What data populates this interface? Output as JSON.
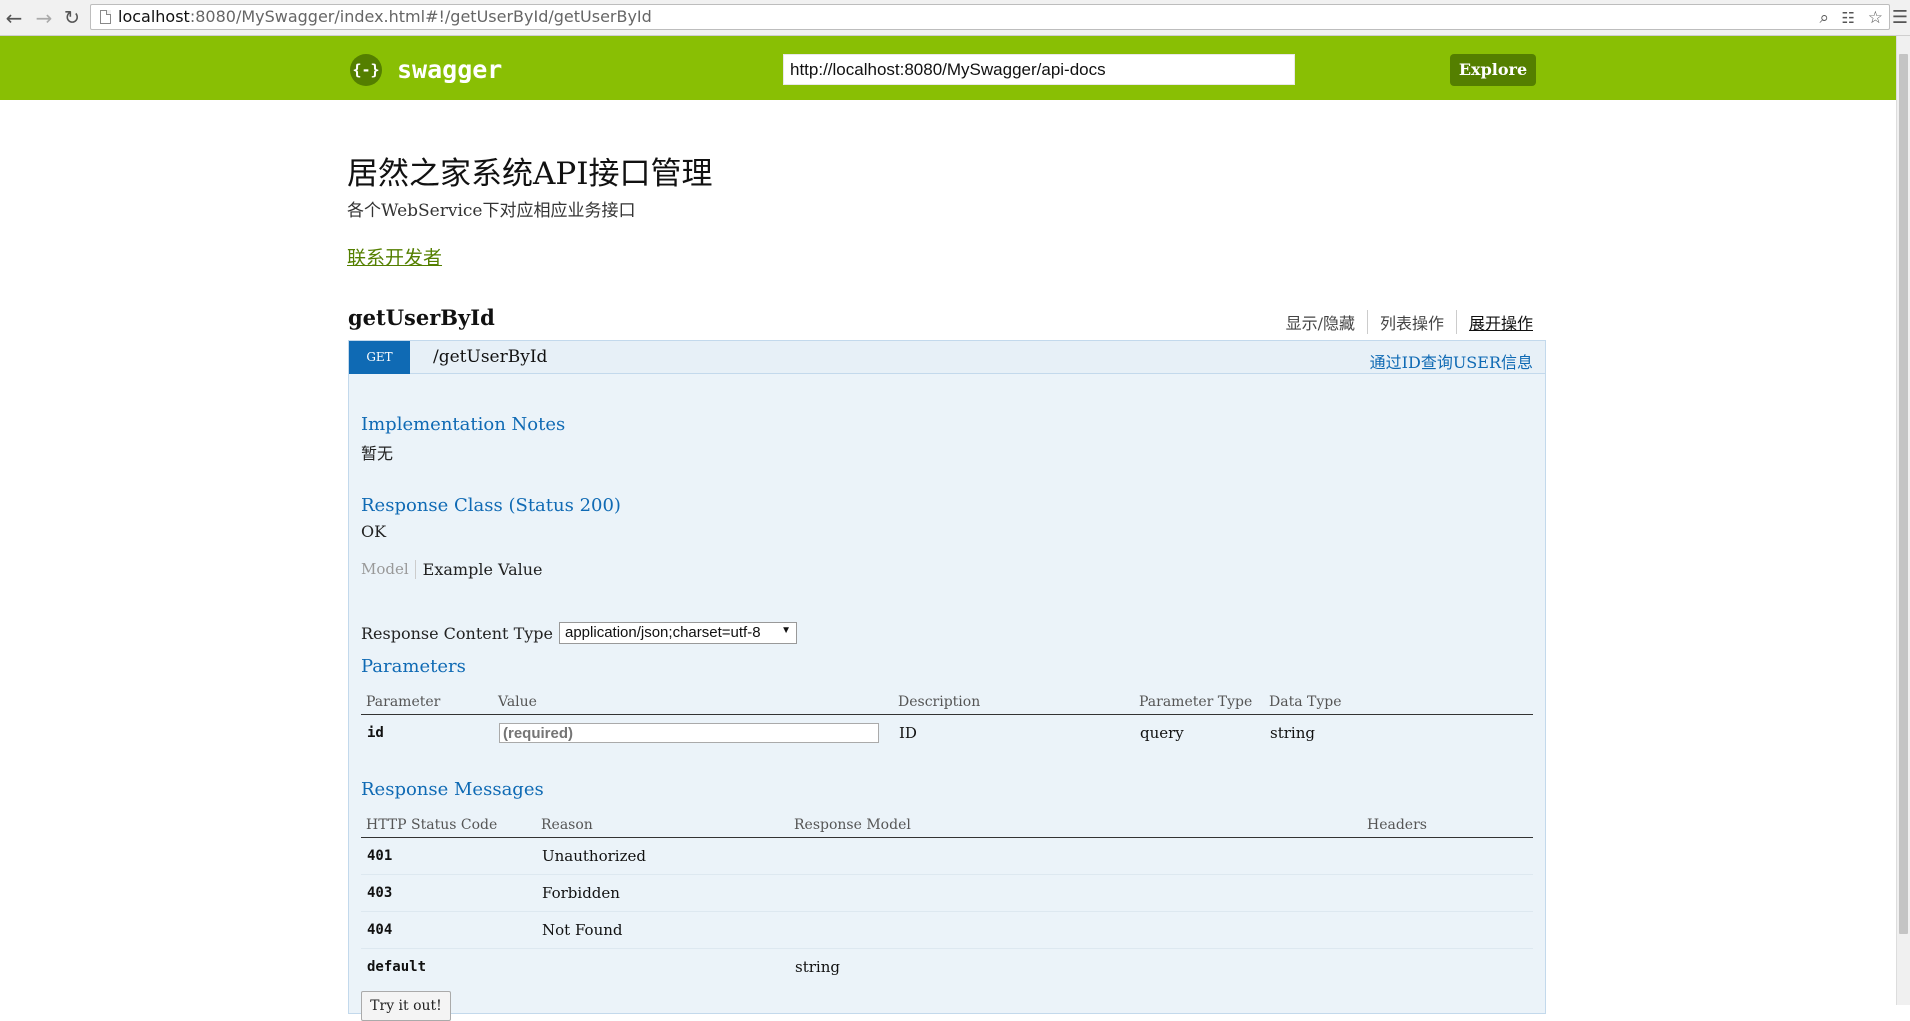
{
  "browser": {
    "url_host": "localhost",
    "url_rest": ":8080/MySwagger/index.html#!/getUserById/getUserById"
  },
  "header": {
    "logo_glyph": "{-}",
    "logo_text": "swagger",
    "api_url": "http://localhost:8080/MySwagger/api-docs",
    "explore_label": "Explore",
    "brand_color": "#89bf04"
  },
  "info": {
    "title": "居然之家系统API接口管理",
    "description": "各个WebService下对应相应业务接口",
    "contact_link": "联系开发者"
  },
  "resource": {
    "name": "getUserById",
    "actions": [
      "显示/隐藏",
      "列表操作",
      "展开操作"
    ]
  },
  "operation": {
    "method": "GET",
    "path": "/getUserById",
    "summary": "通过ID查询USER信息",
    "implementation_notes_heading": "Implementation Notes",
    "implementation_notes": "暂无",
    "response_class_heading": "Response Class (Status 200)",
    "response_class_value": "OK",
    "model_tab": "Model",
    "example_tab": "Example Value",
    "response_content_type_label": "Response Content Type",
    "response_content_type_value": "application/json;charset=utf-8",
    "parameters_heading": "Parameters",
    "param_headers": [
      "Parameter",
      "Value",
      "Description",
      "Parameter Type",
      "Data Type"
    ],
    "params": [
      {
        "name": "id",
        "placeholder": "(required)",
        "description": "ID",
        "param_type": "query",
        "data_type": "string"
      }
    ],
    "response_messages_heading": "Response Messages",
    "resp_headers": [
      "HTTP Status Code",
      "Reason",
      "Response Model",
      "Headers"
    ],
    "responses": [
      {
        "code": "401",
        "reason": "Unauthorized",
        "model": ""
      },
      {
        "code": "403",
        "reason": "Forbidden",
        "model": ""
      },
      {
        "code": "404",
        "reason": "Not Found",
        "model": ""
      },
      {
        "code": "default",
        "reason": "",
        "model": "string"
      }
    ],
    "try_button": "Try it out!",
    "method_color": "#0f6ab4"
  }
}
